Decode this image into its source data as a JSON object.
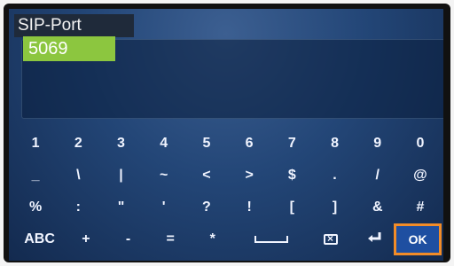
{
  "header": {
    "title": "SIP-Port"
  },
  "field": {
    "value": "5069"
  },
  "keyboard": {
    "row1": [
      "1",
      "2",
      "3",
      "4",
      "5",
      "6",
      "7",
      "8",
      "9",
      "0"
    ],
    "row2": [
      "_",
      "\\",
      "|",
      "~",
      "<",
      ">",
      "$",
      ".",
      "/",
      "@"
    ],
    "row3": [
      "%",
      ":",
      "\"",
      "'",
      "?",
      "!",
      "[",
      "]",
      "&",
      "#"
    ],
    "row4": {
      "abc": "ABC",
      "plus": "+",
      "minus": "-",
      "equals": "=",
      "star": "*",
      "ok": "OK"
    }
  },
  "icons": {
    "space": "space-icon",
    "backspace": "backspace-icon",
    "enter": "enter-icon"
  },
  "colors": {
    "value_bg": "#8cc63f",
    "ok_border": "#f28c28",
    "screen_bg": "#234677"
  }
}
